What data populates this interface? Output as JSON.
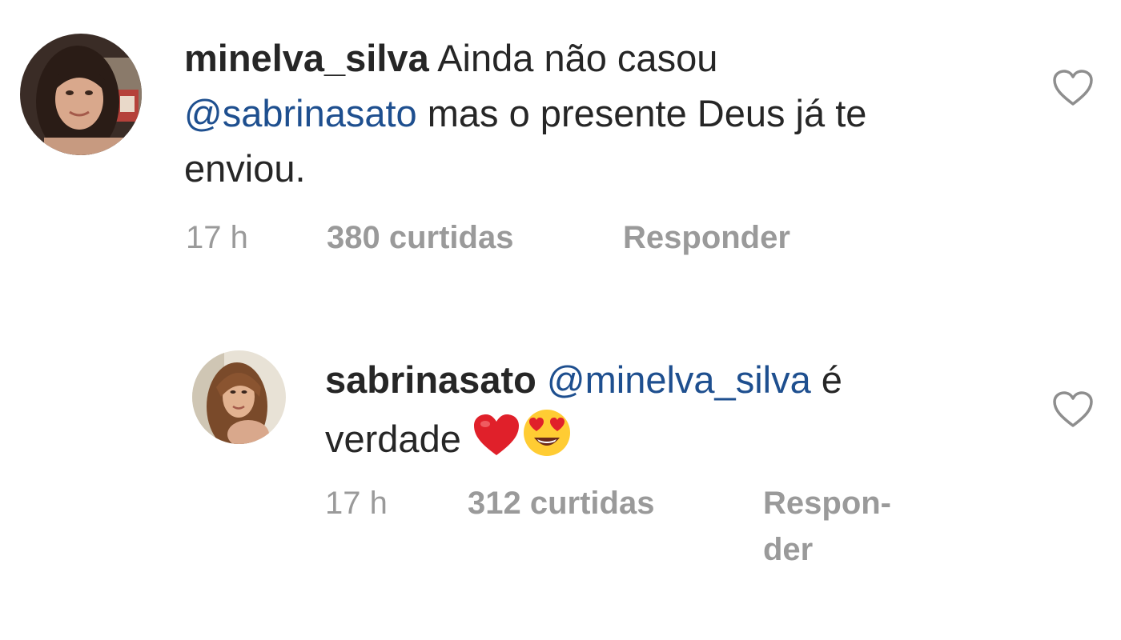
{
  "comments": [
    {
      "username": "minelva_silva",
      "text_before_mention": "Ainda não casou",
      "mention": "@sabrinasato",
      "text_after_mention": "mas o presente Deus já te enviou.",
      "time": "17 h",
      "likes": "380 curtidas",
      "reply_label": "Responder",
      "avatar_icon": "profile-photo",
      "like_icon": "heart-outline-icon"
    },
    {
      "username": "sabrinasato",
      "mention": "@minelva_silva",
      "text_after_mention_line1": "é",
      "text_after_mention_line2": "verdade",
      "emojis": [
        "red-heart-emoji",
        "heart-eyes-emoji"
      ],
      "time": "17 h",
      "likes": "312 curtidas",
      "reply_label_part1": "Respon-",
      "reply_label_part2": "der",
      "avatar_icon": "profile-photo",
      "like_icon": "heart-outline-icon"
    }
  ],
  "colors": {
    "text": "#262626",
    "mention": "#1e4f8f",
    "meta": "#9a9a9a",
    "heart_outline": "#8e8e8e"
  }
}
